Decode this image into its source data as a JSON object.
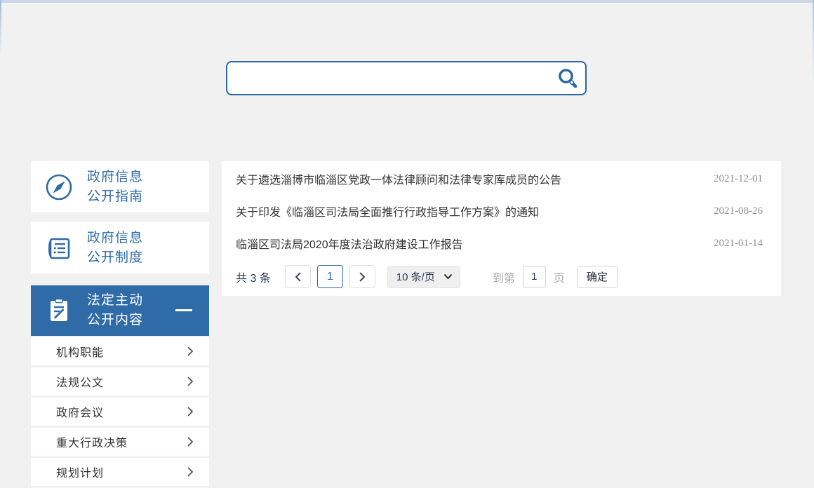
{
  "colors": {
    "accent_blue": "#2f6ba7",
    "search_border_blue": "#2c66a5",
    "page_background": "#f1f1f1",
    "list_title_text": "#333333",
    "date_text": "#8f8f8f",
    "pagination_text": "#2c3a52",
    "muted_text": "#a6a6a6"
  },
  "search": {
    "value": "",
    "placeholder": "",
    "icon": "search-icon"
  },
  "sidebar": {
    "items": [
      {
        "icon": "compass-icon",
        "line1": "政府信息",
        "line2": "公开指南",
        "active": false
      },
      {
        "icon": "open-book-icon",
        "line1": "政府信息",
        "line2": "公开制度",
        "active": false
      },
      {
        "icon": "clipboard-pen-icon",
        "line1": "法定主动",
        "line2": "公开内容",
        "active": true,
        "collapse_icon": "minus-icon"
      }
    ],
    "submenu": [
      {
        "label": "机构职能",
        "icon": "chevron-right-icon"
      },
      {
        "label": "法规公文",
        "icon": "chevron-right-icon"
      },
      {
        "label": "政府会议",
        "icon": "chevron-right-icon"
      },
      {
        "label": "重大行政决策",
        "icon": "chevron-right-icon"
      },
      {
        "label": "规划计划",
        "icon": "chevron-right-icon"
      }
    ]
  },
  "list": {
    "items": [
      {
        "title": "关于遴选淄博市临淄区党政一体法律顾问和法律专家库成员的公告",
        "date": "2021-12-01"
      },
      {
        "title": "关于印发《临淄区司法局全面推行行政指导工作方案》的通知",
        "date": "2021-08-26"
      },
      {
        "title": "临淄区司法局2020年度法治政府建设工作报告",
        "date": "2021-01-14"
      }
    ]
  },
  "pagination": {
    "total": "共 3 条",
    "prev_icon": "chevron-left-icon",
    "current_page": "1",
    "next_icon": "chevron-right-icon",
    "page_size": "10 条/页",
    "page_size_icon": "chevron-down-icon",
    "goto_prefix": "到第",
    "goto_value": "1",
    "goto_suffix": "页",
    "confirm": "确定"
  }
}
